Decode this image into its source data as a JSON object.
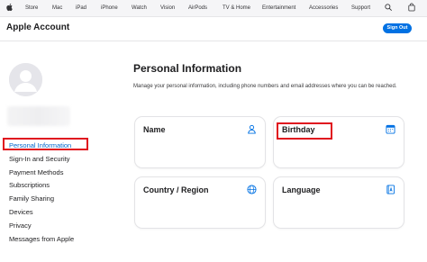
{
  "globalnav": {
    "items": [
      "Store",
      "Mac",
      "iPad",
      "iPhone",
      "Watch",
      "Vision",
      "AirPods",
      "TV & Home",
      "Entertainment",
      "Accessories",
      "Support"
    ]
  },
  "header": {
    "title": "Apple Account",
    "signout_label": "Sign Out"
  },
  "sidebar": {
    "items": [
      {
        "label": "Personal Information",
        "active": true
      },
      {
        "label": "Sign-In and Security",
        "active": false
      },
      {
        "label": "Payment Methods",
        "active": false
      },
      {
        "label": "Subscriptions",
        "active": false
      },
      {
        "label": "Family Sharing",
        "active": false
      },
      {
        "label": "Devices",
        "active": false
      },
      {
        "label": "Privacy",
        "active": false
      },
      {
        "label": "Messages from Apple",
        "active": false
      }
    ]
  },
  "main": {
    "title": "Personal Information",
    "description": "Manage your personal information, including phone numbers and email addresses where you can be reached.",
    "cards": [
      {
        "label": "Name",
        "icon": "person-icon"
      },
      {
        "label": "Birthday",
        "icon": "calendar-icon"
      },
      {
        "label": "Country / Region",
        "icon": "globe-icon"
      },
      {
        "label": "Language",
        "icon": "language-book-icon"
      }
    ]
  },
  "colors": {
    "accent": "#0071e3",
    "link": "#0066cc",
    "highlight": "#e0121e"
  }
}
